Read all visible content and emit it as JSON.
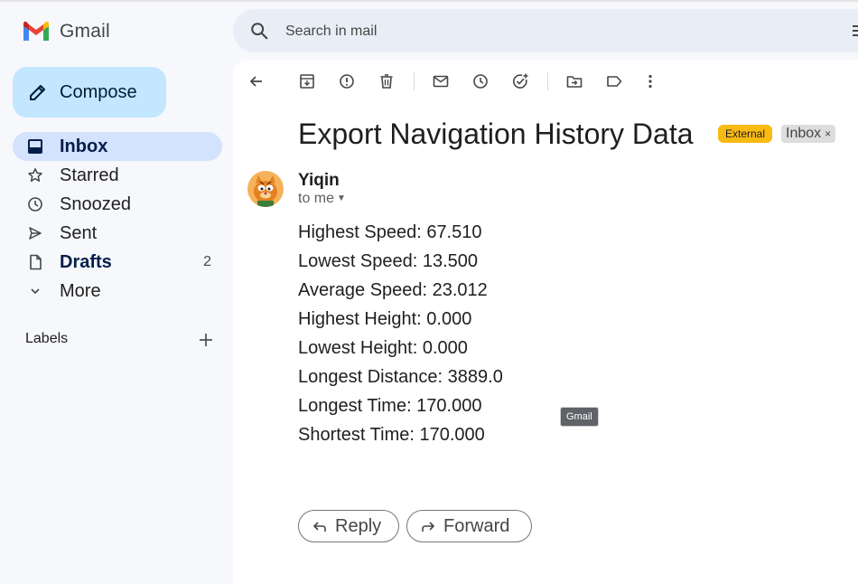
{
  "app": {
    "name": "Gmail"
  },
  "search": {
    "placeholder": "Search in mail"
  },
  "compose": {
    "label": "Compose"
  },
  "nav": {
    "items": [
      {
        "label": "Inbox",
        "icon": "inbox-icon",
        "active": true,
        "bold": true
      },
      {
        "label": "Starred",
        "icon": "star-icon"
      },
      {
        "label": "Snoozed",
        "icon": "clock-icon"
      },
      {
        "label": "Sent",
        "icon": "send-icon"
      },
      {
        "label": "Drafts",
        "icon": "draft-icon",
        "bold": true,
        "count": "2"
      },
      {
        "label": "More",
        "icon": "chevron-down-icon"
      }
    ],
    "labels_heading": "Labels"
  },
  "toolbar": {
    "icons": [
      "back-icon",
      "archive-icon",
      "report-spam-icon",
      "delete-icon",
      "mark-unread-icon",
      "snooze-icon",
      "add-task-icon",
      "move-to-icon",
      "label-icon",
      "more-icon"
    ]
  },
  "email": {
    "subject": "Export Navigation History Data",
    "badges": {
      "external": "External",
      "inbox": "Inbox",
      "inbox_close": "×"
    },
    "sender": "Yiqin",
    "recipient": "to me",
    "body": [
      "Highest Speed: 67.510",
      "Lowest Speed: 13.500",
      "Average Speed: 23.012",
      "Highest Height: 0.000",
      "Lowest Height: 0.000",
      "Longest Distance: 3889.0",
      "Longest Time: 170.000",
      "Shortest Time: 170.000"
    ]
  },
  "tooltip": "Gmail",
  "actions": {
    "reply": "Reply",
    "forward": "Forward"
  },
  "colors": {
    "background": "#f6f8fc",
    "compose": "#c2e7ff",
    "active_nav": "#d3e3fd",
    "external_badge": "#f9ba14",
    "search": "#e9eef6"
  }
}
